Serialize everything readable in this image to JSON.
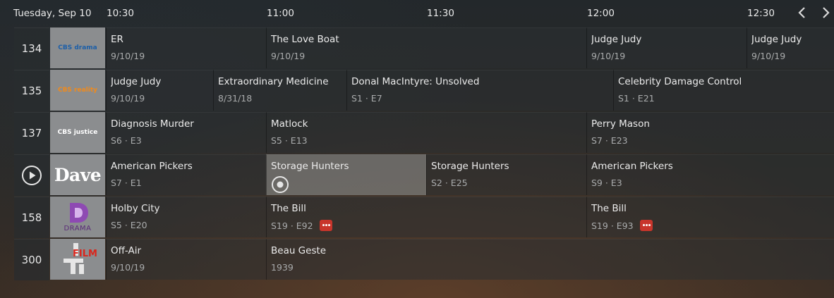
{
  "header": {
    "date": "Tuesday, Sep 10",
    "times": [
      "10:30",
      "11:00",
      "11:30",
      "12:00",
      "12:30"
    ]
  },
  "channels": [
    {
      "number": "134",
      "logo": {
        "text": "CBS drama",
        "icon": "cbs-drama-logo",
        "color": "#1d5fa8"
      },
      "programs": [
        {
          "title": "ER",
          "sub": "9/10/19"
        },
        {
          "title": "The Love Boat",
          "sub": "9/10/19"
        },
        {
          "title": "Judge Judy",
          "sub": "9/10/19"
        },
        {
          "title": "Judge Judy",
          "sub": "9/10/19"
        }
      ]
    },
    {
      "number": "135",
      "logo": {
        "text": "CBS reality",
        "icon": "cbs-reality-logo",
        "color": "#f08a1c"
      },
      "programs": [
        {
          "title": "Judge Judy",
          "sub": "9/10/19"
        },
        {
          "title": "Extraordinary Medicine",
          "sub": "8/31/18"
        },
        {
          "title": "Donal MacIntyre: Unsolved",
          "sub": "S1 · E7"
        },
        {
          "title": "Celebrity Damage Control",
          "sub": "S1 · E21"
        }
      ]
    },
    {
      "number": "137",
      "logo": {
        "text": "CBS justice",
        "icon": "cbs-justice-logo",
        "color": "#ffffff"
      },
      "programs": [
        {
          "title": "Diagnosis Murder",
          "sub": "S6 · E3"
        },
        {
          "title": "Matlock",
          "sub": "S5 · E13"
        },
        {
          "title": "Perry Mason",
          "sub": "S7 · E23"
        }
      ]
    },
    {
      "number": "",
      "logo": {
        "text": "Dave",
        "icon": "dave-logo",
        "color": "#ffffff"
      },
      "programs": [
        {
          "title": "American Pickers",
          "sub": "S7 · E1"
        },
        {
          "title": "Storage Hunters",
          "sub": ""
        },
        {
          "title": "Storage Hunters",
          "sub": "S2 · E25"
        },
        {
          "title": "American Pickers",
          "sub": "S9 · E3"
        }
      ]
    },
    {
      "number": "158",
      "logo": {
        "text": "DRAMA",
        "icon": "drama-logo",
        "color": "#7b3fa0"
      },
      "programs": [
        {
          "title": "Holby City",
          "sub": "S5 · E20"
        },
        {
          "title": "The Bill",
          "sub": "S19 · E92"
        },
        {
          "title": "The Bill",
          "sub": "S19 · E93"
        }
      ]
    },
    {
      "number": "300",
      "logo": {
        "text": "FILM",
        "icon": "film4-logo",
        "color": "#d9261c"
      },
      "programs": [
        {
          "title": "Off-Air",
          "sub": "9/10/19"
        },
        {
          "title": "Beau Geste",
          "sub": "1939"
        }
      ]
    }
  ],
  "icons": {
    "prev": "chevron-left-icon",
    "next": "chevron-right-icon",
    "play": "play-circle-icon",
    "record": "record-icon",
    "live": "live-indicator-icon"
  },
  "colors": {
    "record_badge": "#c8352b",
    "selected_cell": "#787876"
  }
}
